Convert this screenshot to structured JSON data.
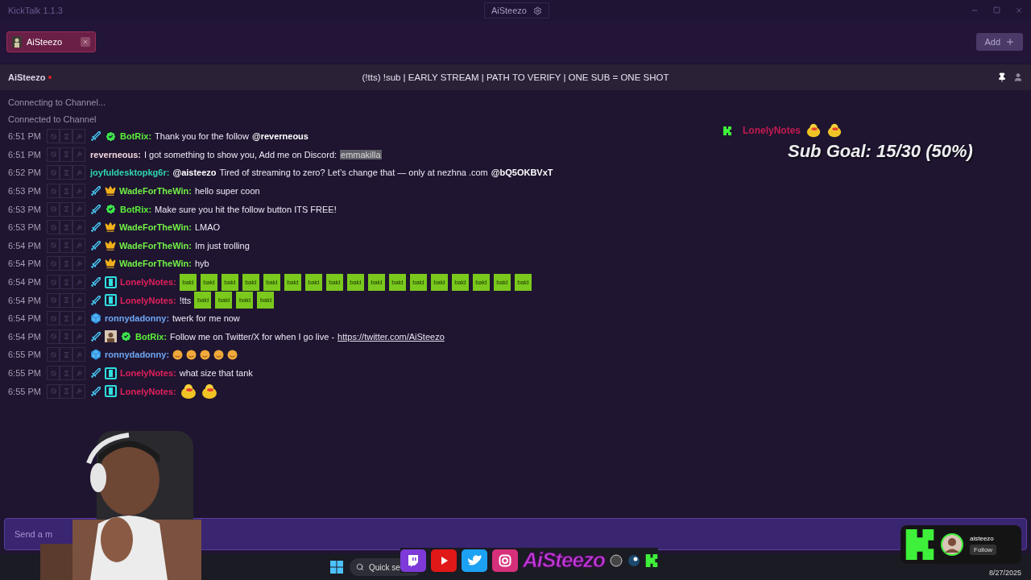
{
  "app": {
    "title": "KickTalk 1.1.3",
    "center_tab": "AiSteezo"
  },
  "tabs": [
    {
      "label": "AiSteezo",
      "selected": true
    }
  ],
  "add_button": "Add",
  "channel": {
    "name": "AiSteezo",
    "live": true,
    "title": "(!tts) !sub | EARLY STREAM | PATH TO VERIFY | ONE SUB = ONE SHOT"
  },
  "system_messages": [
    "Connecting to Channel...",
    "Connected to Channel"
  ],
  "messages": [
    {
      "time": "6:51 PM",
      "badges": [
        {
          "kind": "sword"
        },
        {
          "kind": "verified"
        }
      ],
      "user": "BotRix:",
      "color": "#5cf03a",
      "segments": [
        {
          "kind": "text",
          "text": "Thank you for the follow"
        },
        {
          "kind": "mention",
          "text": "@reverneous"
        }
      ]
    },
    {
      "time": "6:51 PM",
      "user": "reverneous:",
      "color": "#f3d6df",
      "segments": [
        {
          "kind": "text",
          "text": "I got something to show you, Add me on Discord:"
        },
        {
          "kind": "highlight",
          "text": "emmakilla"
        }
      ]
    },
    {
      "time": "6:52 PM",
      "user": "joyfuldesktopkg6r:",
      "color": "#2ed6b0",
      "segments": [
        {
          "kind": "mention",
          "text": "@aisteezo"
        },
        {
          "kind": "text",
          "text": "Tired of streaming to zero? Let’s change that — only at nezhna .com"
        },
        {
          "kind": "mention",
          "text": "@bQ5OKBVxT"
        }
      ]
    },
    {
      "time": "6:53 PM",
      "badges": [
        {
          "kind": "sword"
        },
        {
          "kind": "crown"
        }
      ],
      "user": "WadeForTheWin:",
      "color": "#72f046",
      "segments": [
        {
          "kind": "text",
          "text": "hello super coon"
        }
      ]
    },
    {
      "time": "6:53 PM",
      "badges": [
        {
          "kind": "sword"
        },
        {
          "kind": "verified"
        }
      ],
      "user": "BotRix:",
      "color": "#5cf03a",
      "segments": [
        {
          "kind": "text",
          "text": "Make sure you hit the follow button ITS FREE!"
        }
      ]
    },
    {
      "time": "6:53 PM",
      "badges": [
        {
          "kind": "sword"
        },
        {
          "kind": "crown"
        }
      ],
      "user": "WadeForTheWin:",
      "color": "#72f046",
      "segments": [
        {
          "kind": "text",
          "text": "LMAO"
        }
      ]
    },
    {
      "time": "6:54 PM",
      "badges": [
        {
          "kind": "sword"
        },
        {
          "kind": "crown"
        }
      ],
      "user": "WadeForTheWin:",
      "color": "#72f046",
      "segments": [
        {
          "kind": "text",
          "text": "Im just trolling"
        }
      ]
    },
    {
      "time": "6:54 PM",
      "badges": [
        {
          "kind": "sword"
        },
        {
          "kind": "crown"
        }
      ],
      "user": "WadeForTheWin:",
      "color": "#72f046",
      "segments": [
        {
          "kind": "text",
          "text": "hyb"
        }
      ]
    },
    {
      "time": "6:54 PM",
      "badges": [
        {
          "kind": "sword"
        },
        {
          "kind": "og"
        }
      ],
      "user": "LonelyNotes:",
      "color": "#e2215c",
      "segments": [
        {
          "kind": "emote",
          "text": "bald"
        },
        {
          "kind": "emote",
          "text": "bald"
        },
        {
          "kind": "emote",
          "text": "bald"
        },
        {
          "kind": "emote",
          "text": "bald"
        },
        {
          "kind": "emote",
          "text": "bald"
        },
        {
          "kind": "emote",
          "text": "bald"
        },
        {
          "kind": "emote",
          "text": "bald"
        },
        {
          "kind": "emote",
          "text": "bald"
        },
        {
          "kind": "emote",
          "text": "bald"
        },
        {
          "kind": "emote",
          "text": "bald"
        },
        {
          "kind": "emote",
          "text": "bald"
        },
        {
          "kind": "emote",
          "text": "bald"
        },
        {
          "kind": "emote",
          "text": "bald"
        },
        {
          "kind": "emote",
          "text": "bald"
        },
        {
          "kind": "emote",
          "text": "bald"
        },
        {
          "kind": "emote",
          "text": "bald"
        },
        {
          "kind": "emote",
          "text": "bald"
        }
      ]
    },
    {
      "time": "6:54 PM",
      "badges": [
        {
          "kind": "sword"
        },
        {
          "kind": "og"
        }
      ],
      "user": "LonelyNotes:",
      "color": "#e2215c",
      "segments": [
        {
          "kind": "text",
          "text": "!tts"
        },
        {
          "kind": "emote",
          "text": "bald"
        },
        {
          "kind": "emote",
          "text": "bald"
        },
        {
          "kind": "emote",
          "text": "bald"
        },
        {
          "kind": "emote",
          "text": "bald"
        }
      ]
    },
    {
      "time": "6:54 PM",
      "badges": [
        {
          "kind": "cube"
        }
      ],
      "user": "ronnydadonny:",
      "color": "#6fa8f5",
      "segments": [
        {
          "kind": "text",
          "text": "twerk for me now"
        }
      ]
    },
    {
      "time": "6:54 PM",
      "badges": [
        {
          "kind": "sword"
        },
        {
          "kind": "avatar"
        },
        {
          "kind": "verified"
        }
      ],
      "user": "BotRix:",
      "color": "#5cf03a",
      "segments": [
        {
          "kind": "text",
          "text": "Follow me on Twitter/X for when I go live -"
        },
        {
          "kind": "link",
          "text": "https://twitter.com/AiSteezo"
        }
      ]
    },
    {
      "time": "6:55 PM",
      "badges": [
        {
          "kind": "cube"
        }
      ],
      "user": "ronnydadonny:",
      "color": "#6fa8f5",
      "segments": [
        {
          "kind": "smiley"
        },
        {
          "kind": "smiley"
        },
        {
          "kind": "smiley"
        },
        {
          "kind": "smiley"
        },
        {
          "kind": "smiley"
        }
      ]
    },
    {
      "time": "6:55 PM",
      "badges": [
        {
          "kind": "sword"
        },
        {
          "kind": "og"
        }
      ],
      "user": "LonelyNotes:",
      "color": "#e2215c",
      "segments": [
        {
          "kind": "text",
          "text": "what size that tank"
        }
      ]
    },
    {
      "time": "6:55 PM",
      "badges": [
        {
          "kind": "sword"
        },
        {
          "kind": "og"
        }
      ],
      "user": "LonelyNotes:",
      "color": "#e2215c",
      "segments": [
        {
          "kind": "duck"
        },
        {
          "kind": "duck"
        }
      ]
    }
  ],
  "overlay": {
    "alert": {
      "user": "LonelyNotes",
      "emotes": [
        {
          "kind": "duck"
        },
        {
          "kind": "duck"
        }
      ]
    },
    "sub_goal": "Sub Goal: 15/30 (50%)"
  },
  "input": {
    "placeholder": "Send a m"
  },
  "taskbar": {
    "search": "Quick se",
    "brand": "AiSteezo",
    "date": "8/27/2025"
  },
  "follow_widget": {
    "name": "aisteezo",
    "button": "Follow"
  }
}
